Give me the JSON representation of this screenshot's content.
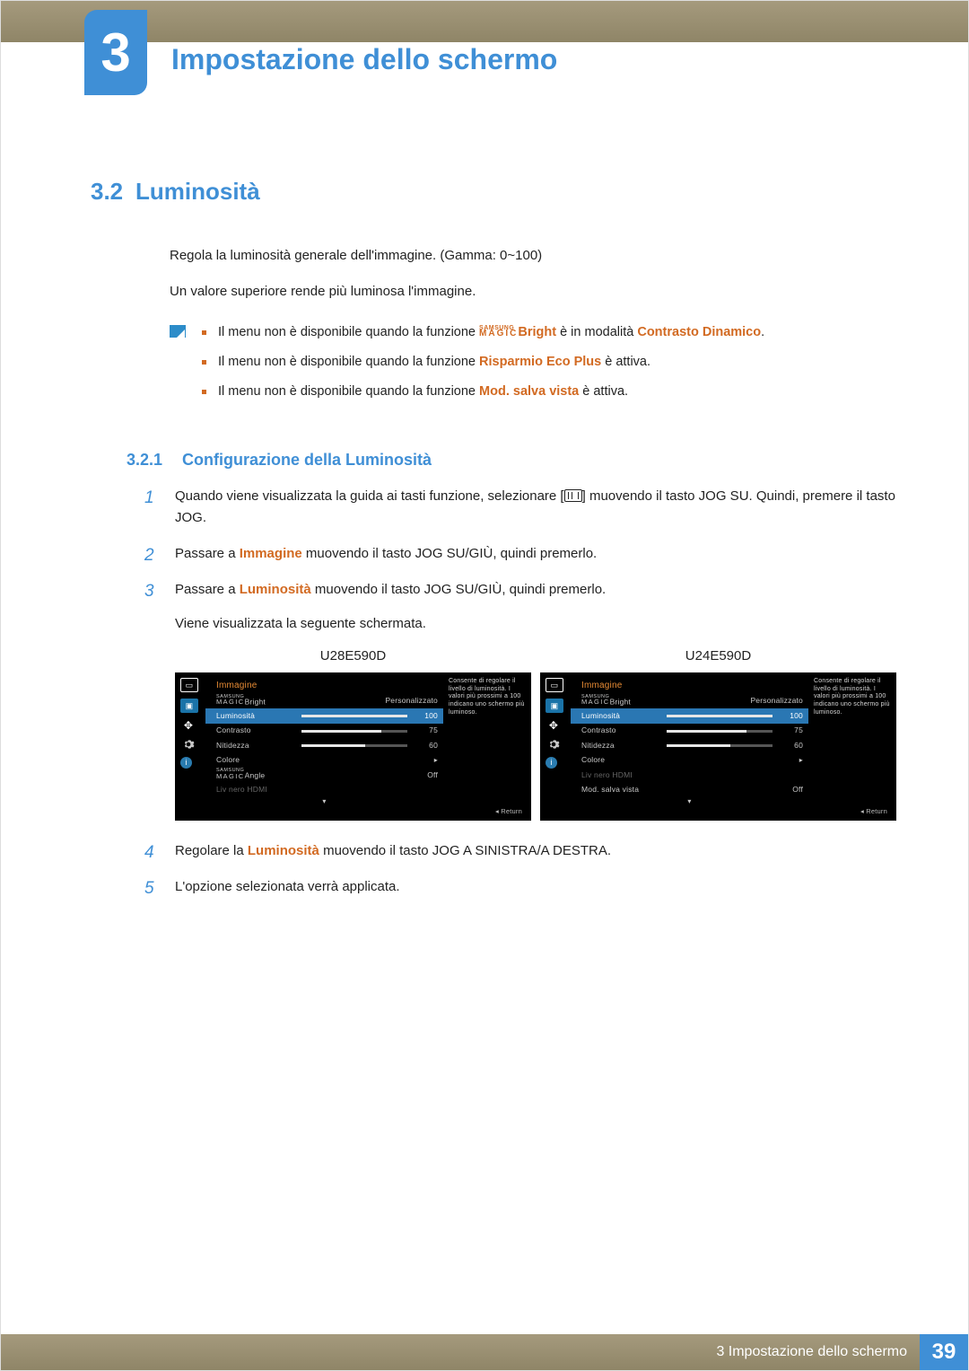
{
  "chapter": {
    "number": "3",
    "title": "Impostazione dello schermo"
  },
  "section": {
    "number": "3.2",
    "title": "Luminosità"
  },
  "intro": {
    "p1": "Regola la luminosità generale dell'immagine. (Gamma: 0~100)",
    "p2": "Un valore superiore rende più luminosa l'immagine."
  },
  "notes": {
    "n1_pre": "Il menu non è disponibile quando la funzione ",
    "n1_samsung": "SAMSUNG",
    "n1_magic": "MAGIC",
    "n1_bright": "Bright",
    "n1_mid": " è in modalità ",
    "n1_term": "Contrasto Dinamico",
    "n1_suf": ".",
    "n2_pre": "Il menu non è disponibile quando la funzione ",
    "n2_term": "Risparmio Eco Plus",
    "n2_suf": " è attiva.",
    "n3_pre": "Il menu non è disponibile quando la funzione ",
    "n3_term": "Mod. salva vista",
    "n3_suf": " è attiva."
  },
  "subsection": {
    "number": "3.2.1",
    "title": "Configurazione della Luminosità"
  },
  "steps": {
    "s1a": "Quando viene visualizzata la guida ai tasti funzione, selezionare [",
    "s1b": "] muovendo il tasto JOG SU. Quindi, premere il tasto JOG.",
    "s2_pre": "Passare a ",
    "s2_term": "Immagine",
    "s2_suf": " muovendo il tasto JOG SU/GIÙ, quindi premerlo.",
    "s3_pre": "Passare a ",
    "s3_term": "Luminosità",
    "s3_suf": " muovendo il tasto JOG SU/GIÙ, quindi premerlo.",
    "s3_extra": "Viene visualizzata la seguente schermata.",
    "s4_pre": "Regolare la ",
    "s4_term": "Luminosità",
    "s4_suf": " muovendo il tasto JOG A SINISTRA/A DESTRA.",
    "s5": "L'opzione selezionata verrà applicata."
  },
  "shots": {
    "left_label": "U28E590D",
    "right_label": "U24E590D",
    "hint": "Consente di regolare il livello di luminosità. I valori più prossimi a 100 indicano uno schermo più luminoso.",
    "return": "Return",
    "left": {
      "title": "Immagine",
      "magic_samsung": "SAMSUNG",
      "magic_word": "MAGIC",
      "magic_suffix": "Bright",
      "magic_val": "Personalizzato",
      "rows": [
        {
          "label": "Luminosità",
          "val": "100",
          "pct": 100,
          "sel": true
        },
        {
          "label": "Contrasto",
          "val": "75",
          "pct": 75
        },
        {
          "label": "Nitidezza",
          "val": "60",
          "pct": 60
        }
      ],
      "colore": "Colore",
      "angle_samsung": "SAMSUNG",
      "angle_word": "MAGIC",
      "angle_suffix": "Angle",
      "angle_val": "Off",
      "last": "Liv nero HDMI"
    },
    "right": {
      "title": "Immagine",
      "magic_samsung": "SAMSUNG",
      "magic_word": "MAGIC",
      "magic_suffix": "Bright",
      "magic_val": "Personalizzato",
      "rows": [
        {
          "label": "Luminosità",
          "val": "100",
          "pct": 100,
          "sel": true
        },
        {
          "label": "Contrasto",
          "val": "75",
          "pct": 75
        },
        {
          "label": "Nitidezza",
          "val": "60",
          "pct": 60
        }
      ],
      "colore": "Colore",
      "liv": "Liv nero HDMI",
      "mod_label": "Mod. salva vista",
      "mod_val": "Off"
    }
  },
  "footer": {
    "text": "3 Impostazione dello schermo",
    "page": "39"
  }
}
